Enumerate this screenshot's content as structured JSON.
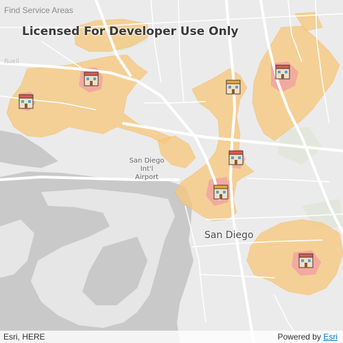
{
  "app": {
    "title": "Find Service Areas",
    "watermark": "Licensed For Developer Use Only"
  },
  "map_labels": {
    "airport_line1": "San Diego",
    "airport_line2": "Int'l Airport",
    "city": "San Diego",
    "road_fragment": "Ruell"
  },
  "attribution": {
    "sources": "Esri, HERE",
    "powered_by": "Powered by",
    "provider": "Esri"
  },
  "colors": {
    "land": "#ebebeb",
    "water": "#c9c9c9",
    "service_area_outer": "#f5c97a",
    "service_area_inner": "#f2a0a5",
    "road": "#ffffff"
  },
  "facilities": [
    {
      "name": "facility",
      "icon": "hospital-icon"
    },
    {
      "name": "facility",
      "icon": "hospital-icon"
    },
    {
      "name": "facility",
      "icon": "hospital-icon"
    },
    {
      "name": "facility",
      "icon": "hospital-icon"
    },
    {
      "name": "facility",
      "icon": "hospital-icon"
    },
    {
      "name": "facility",
      "icon": "hospital-icon"
    },
    {
      "name": "facility",
      "icon": "hospital-icon"
    }
  ]
}
